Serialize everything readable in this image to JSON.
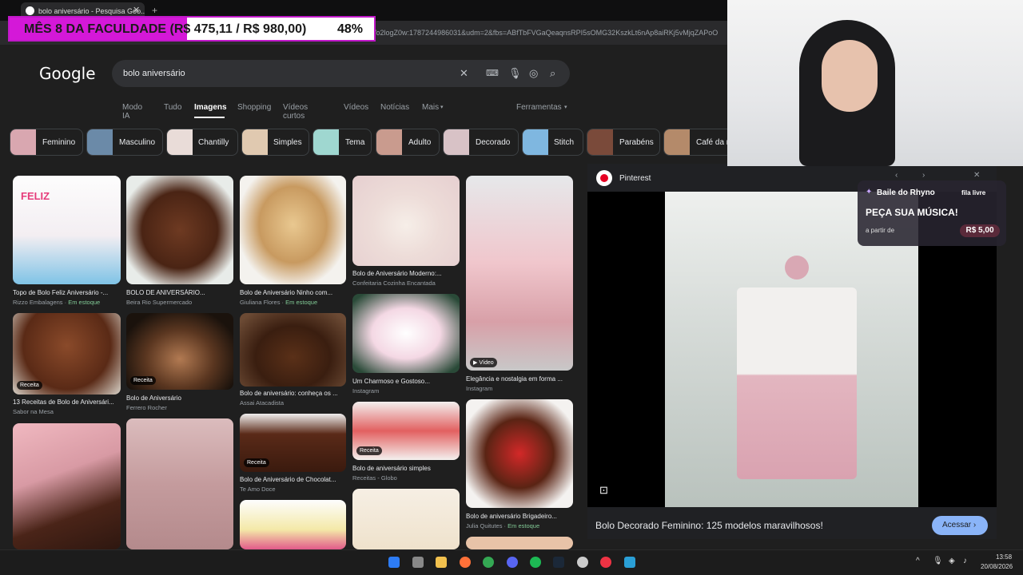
{
  "browser": {
    "tab_title": "bolo aniversário - Pesquisa Goo...",
    "url_fragment": "Vo2logZ0w:1787244986031&udm=2&fbs=ABfTbFVGaQeaqnsRPI5sOMG32KszkLt6nAp8aiRKj5vMjqZAPoO"
  },
  "banner": {
    "label": "MÊS 8 DA FACULDADE (R$ 475,11 / R$ 980,00)",
    "percent": "48%",
    "progress": 0.48
  },
  "google": {
    "logo": "Google",
    "query": "bolo aniversário",
    "tabs": [
      "Modo IA",
      "Tudo",
      "Imagens",
      "Shopping",
      "Vídeos curtos",
      "Vídeos",
      "Notícias",
      "Mais"
    ],
    "tools": "Ferramentas"
  },
  "chips": [
    "Feminino",
    "Masculino",
    "Chantilly",
    "Simples",
    "Tema",
    "Adulto",
    "Decorado",
    "Stitch",
    "Parabéns",
    "Café da m"
  ],
  "results": [
    {
      "caption": "Topo de Bolo Feliz Aniversário -...",
      "source": "Rizzo Embalagens",
      "stock": "Em estoque"
    },
    {
      "caption": "BOLO DE ANIVERSÁRIO...",
      "source": "Beira Rio Supermercado",
      "stock": ""
    },
    {
      "caption": "Bolo de Aniversário Ninho com...",
      "source": "Giuliana Flores",
      "stock": "Em estoque"
    },
    {
      "caption": "Bolo de Aniversário Moderno:...",
      "source": "Confeitaria Cozinha Encantada",
      "stock": ""
    },
    {
      "caption": "Elegância e nostalgia em forma ...",
      "source": "Instagram",
      "stock": ""
    },
    {
      "caption": "13 Receitas de Bolo de Aniversári...",
      "source": "Sabor na Mesa",
      "stock": ""
    },
    {
      "caption": "Bolo de Aniversário",
      "source": "Ferrero Rocher",
      "stock": ""
    },
    {
      "caption": "Bolo de aniversário: conheça os ...",
      "source": "Assai Atacadista",
      "stock": ""
    },
    {
      "caption": "Um Charmoso e Gostoso...",
      "source": "Instagram",
      "stock": ""
    },
    {
      "caption": "Bolo de aniversário simples",
      "source": "Receitas - Globo",
      "stock": ""
    },
    {
      "caption": "Bolo de Aniversário de Chocolat...",
      "source": "Te Amo Doce",
      "stock": ""
    },
    {
      "caption": "Bolo de aniversário Brigadeiro...",
      "source": "Julia Quitutes",
      "stock": "Em estoque"
    }
  ],
  "badges": {
    "receita": "Receita",
    "video": "Vídeo"
  },
  "panel": {
    "source": "Pinterest",
    "title": "Bolo Decorado Feminino: 125 modelos maravilhosos!",
    "visit": "Acessar"
  },
  "ad": {
    "channel": "Baile do Rhyno",
    "queue": "fila livre",
    "headline": "PEÇA SUA MÚSICA!",
    "from": "a partir de",
    "price": "R$ 5,00"
  },
  "taskbar": {
    "time": "13:58",
    "date": "20/08/2026"
  }
}
